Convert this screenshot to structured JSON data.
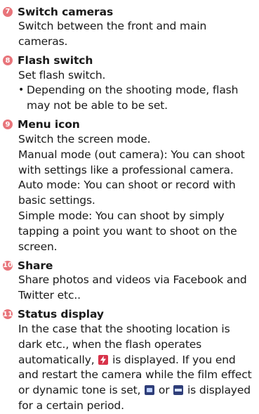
{
  "items": [
    {
      "num": "7",
      "title": "Switch cameras",
      "lines": [
        "Switch between the front and main cameras."
      ]
    },
    {
      "num": "8",
      "title": "Flash switch",
      "lines": [
        "Set flash switch."
      ],
      "bullet": "Depending on the shooting mode, flash may not be able to be set."
    },
    {
      "num": "9",
      "title": "Menu icon",
      "lines": [
        "Switch the screen mode.",
        "Manual mode (out camera): You can shoot with settings like a professional camera.",
        "Auto mode: You can shoot or record with basic settings.",
        "Simple mode: You can shoot by simply tapping a point you want to shoot on the screen."
      ]
    },
    {
      "num": "10",
      "title": "Share",
      "lines": [
        "Share photos and videos via Facebook and Twitter etc.."
      ]
    },
    {
      "num": "11",
      "title": "Status display",
      "p1": "In the case that the shooting location is dark etc., when the flash operates automatically,",
      "p2": "is displayed. If you end and restart the camera while the film effect or dynamic tone is set,",
      "p3": "or",
      "p4": "is displayed for a certain period."
    }
  ],
  "icons": {
    "badge_color": "#e8747a",
    "flash": "flash-auto-icon",
    "film": "film-effect-icon",
    "tone": "dynamic-tone-icon"
  }
}
